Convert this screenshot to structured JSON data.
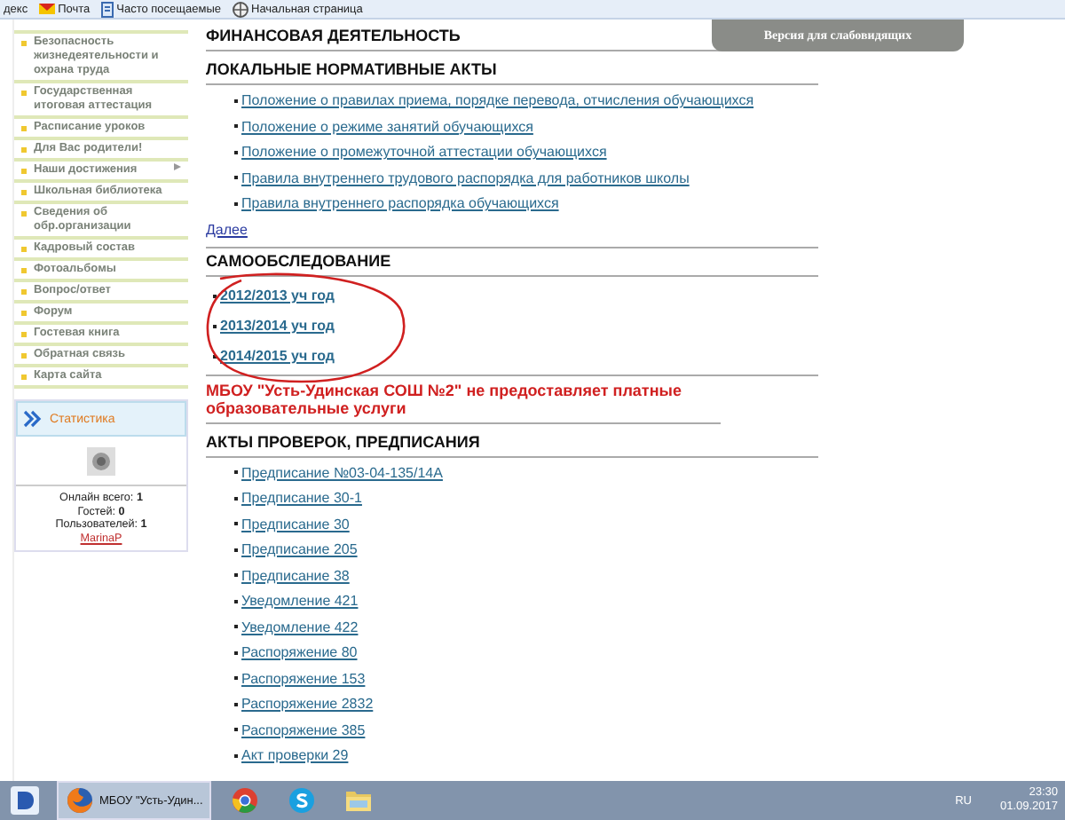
{
  "bookmarks": [
    {
      "label": "декс"
    },
    {
      "label": "Почта"
    },
    {
      "label": "Часто посещаемые"
    },
    {
      "label": "Начальная страница"
    }
  ],
  "sidebar": {
    "menu": [
      {
        "label": "Безопасность жизнедеятельности и охрана труда",
        "has_submenu": false
      },
      {
        "label": "Государственная итоговая аттестация",
        "has_submenu": false
      },
      {
        "label": "Расписание уроков",
        "has_submenu": false
      },
      {
        "label": "Для Вас родители!",
        "has_submenu": false
      },
      {
        "label": "Наши достижения",
        "has_submenu": true
      },
      {
        "label": "Школьная библиотека",
        "has_submenu": false
      },
      {
        "label": "Сведения об обр.организации",
        "has_submenu": false
      },
      {
        "label": "Кадровый состав",
        "has_submenu": false
      },
      {
        "label": "Фотоальбомы",
        "has_submenu": false
      },
      {
        "label": "Вопрос/ответ",
        "has_submenu": false
      },
      {
        "label": "Форум",
        "has_submenu": false
      },
      {
        "label": "Гостевая книга",
        "has_submenu": false
      },
      {
        "label": "Обратная связь",
        "has_submenu": false
      },
      {
        "label": "Карта сайта",
        "has_submenu": false
      }
    ],
    "statistics": {
      "title": "Статистика",
      "lines": [
        {
          "label": "Онлайн всего:",
          "value": "1"
        },
        {
          "label": "Гостей:",
          "value": "0"
        },
        {
          "label": "Пользователей:",
          "value": "1"
        }
      ],
      "user": "MarinaP"
    }
  },
  "accessibility_button": "Версия для слабовидящих",
  "sections": [
    {
      "kind": "heading",
      "title": "ФИНАНСОВАЯ ДЕЯТЕЛЬНОСТЬ"
    },
    {
      "kind": "links",
      "title": "ЛОКАЛЬНЫЕ НОРМАТИВНЫЕ АКТЫ",
      "bold": false,
      "circled": false,
      "more": "Далее",
      "links": [
        "Положение о правилах приема, порядке перевода, отчисления обучающихся",
        "Положение о режиме занятий обучающихся",
        "Положение о промежуточной аттестации обучающихся",
        "Правила внутреннего трудового распорядка для работников школы",
        "Правила внутреннего распорядка обучающихся"
      ]
    },
    {
      "kind": "links",
      "title": "САМООБСЛЕДОВАНИЕ",
      "bold": true,
      "circled": true,
      "links": [
        "2012/2013 уч год",
        "2013/2014 уч год",
        "2014/2015 уч год"
      ]
    },
    {
      "kind": "notice",
      "text": "МБОУ \"Усть-Удинская СОШ №2\" не предоставляет платные образовательные услуги"
    },
    {
      "kind": "links",
      "title": "АКТЫ ПРОВЕРОК, ПРЕДПИСАНИЯ",
      "bold": false,
      "circled": false,
      "links": [
        "Предписание №03-04-135/14А",
        "Предписание 30-1",
        "Предписание 30",
        "Предписание 205",
        "Предписание 38",
        "Уведомление 421",
        "Уведомление 422",
        "Распоряжение 80",
        "Распоряжение 153",
        "Распоряжение 2832",
        "Распоряжение 385",
        "Акт проверки 29"
      ]
    }
  ],
  "taskbar": {
    "tasks": [
      {
        "label": "МБОУ \"Усть-Удин...",
        "selected": true
      },
      {
        "selected": false
      },
      {
        "selected": false
      },
      {
        "selected": false
      }
    ],
    "language": "RU",
    "time": "23:30",
    "date": "01.09.2017"
  }
}
